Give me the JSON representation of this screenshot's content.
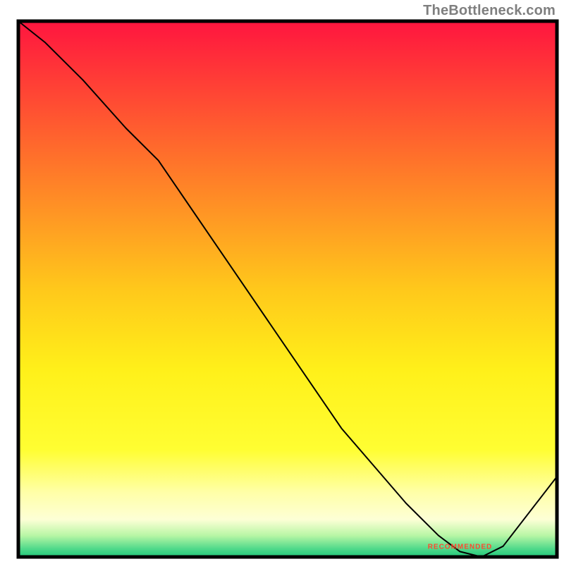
{
  "attribution": "TheBottleneck.com",
  "chart_data": {
    "type": "line",
    "title": "",
    "xlabel": "",
    "ylabel": "",
    "xlim": [
      0,
      100
    ],
    "ylim": [
      0,
      100
    ],
    "grid": false,
    "legend": false,
    "background": {
      "type": "vertical-gradient",
      "stops": [
        {
          "offset": 0.0,
          "color": "#ff153f"
        },
        {
          "offset": 0.25,
          "color": "#ff6f2b"
        },
        {
          "offset": 0.5,
          "color": "#ffc81b"
        },
        {
          "offset": 0.65,
          "color": "#fff01a"
        },
        {
          "offset": 0.8,
          "color": "#fffe32"
        },
        {
          "offset": 0.88,
          "color": "#ffffa8"
        },
        {
          "offset": 0.93,
          "color": "#fdffd6"
        },
        {
          "offset": 0.96,
          "color": "#b8f6a5"
        },
        {
          "offset": 0.985,
          "color": "#4fd98a"
        },
        {
          "offset": 1.0,
          "color": "#21c87a"
        }
      ]
    },
    "series": [
      {
        "name": "curve",
        "color": "#000000",
        "width": 2,
        "x": [
          0,
          5,
          12,
          20,
          26,
          60,
          72,
          78,
          82,
          86,
          90,
          100
        ],
        "y": [
          100,
          96,
          89,
          80,
          74,
          24,
          10,
          4,
          1,
          0,
          2,
          15
        ]
      }
    ],
    "annotations": [
      {
        "text": "RECOMMENDED",
        "x": 82,
        "y": 1.5,
        "color": "#ff4a2f",
        "font_size": 10,
        "weight": "bold",
        "anchor": "middle"
      }
    ]
  }
}
